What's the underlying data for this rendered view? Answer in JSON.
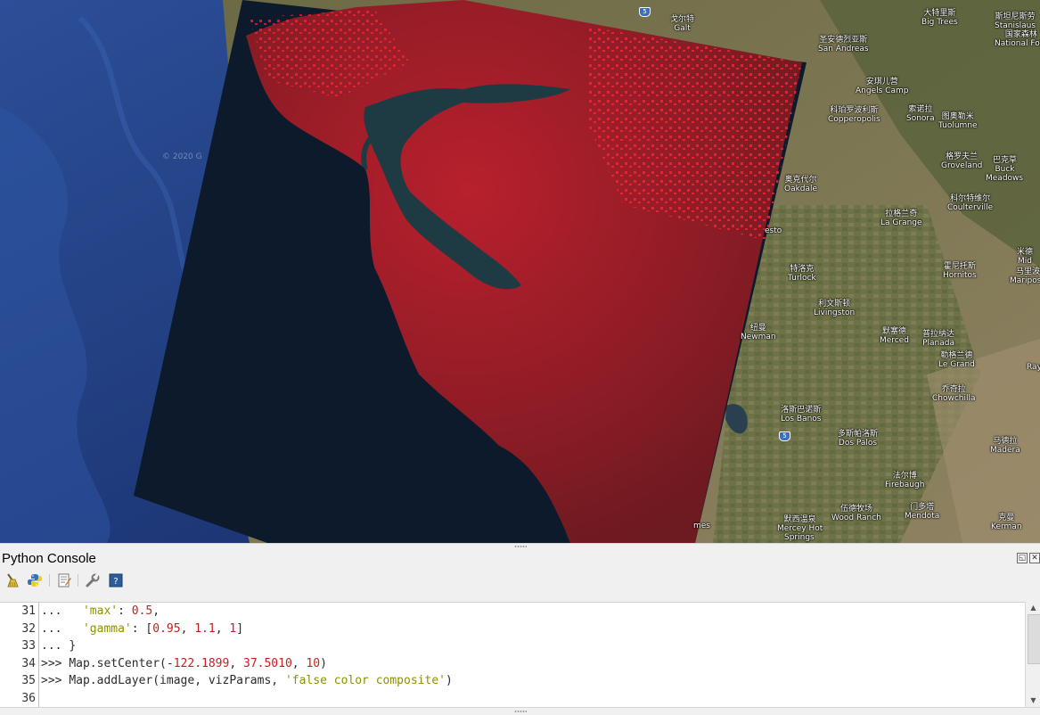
{
  "map": {
    "places": [
      {
        "zh": "戈尔特",
        "en": "Galt"
      },
      {
        "zh": "圣安德烈亚斯",
        "en": "San Andreas"
      },
      {
        "zh": "大特里斯",
        "en": "Big Trees"
      },
      {
        "zh": "斯坦尼斯劳",
        "en": "Stanislaus"
      },
      {
        "zh": "国家森林",
        "en": "National Fore"
      },
      {
        "zh": "安琪儿营",
        "en": "Angels Camp"
      },
      {
        "zh": "科珀罗波利斯",
        "en": "Copperopolis"
      },
      {
        "zh": "索诺拉",
        "en": "Sonora"
      },
      {
        "zh": "图奥勒米",
        "en": "Tuolumne"
      },
      {
        "zh": "格罗夫兰",
        "en": "Groveland"
      },
      {
        "zh": "巴克草",
        "en": "Buck"
      },
      {
        "zh": "",
        "en": "Meadows"
      },
      {
        "zh": "奥克代尔",
        "en": "Oakdale"
      },
      {
        "zh": "科尔特维尔",
        "en": "Coulterville"
      },
      {
        "zh": "拉格兰奇",
        "en": "La Grange"
      },
      {
        "zh": "特洛克",
        "en": "Turlock"
      },
      {
        "zh": "霍尼托斯",
        "en": "Hornitos"
      },
      {
        "zh": "利文斯顿",
        "en": "Livingston"
      },
      {
        "zh": "纽曼",
        "en": "Newman"
      },
      {
        "zh": "默塞德",
        "en": "Merced"
      },
      {
        "zh": "普拉纳达",
        "en": "Planada"
      },
      {
        "zh": "勒格兰德",
        "en": "Le Grand"
      },
      {
        "zh": "乔奇拉",
        "en": "Chowchilla"
      },
      {
        "zh": "洛斯巴诺斯",
        "en": "Los Banos"
      },
      {
        "zh": "多斯帕洛斯",
        "en": "Dos Palos"
      },
      {
        "zh": "马德拉",
        "en": "Madera"
      },
      {
        "zh": "法尔博",
        "en": "Firebaugh"
      },
      {
        "zh": "伍德牧场",
        "en": "Wood Ranch"
      },
      {
        "zh": "门多塔",
        "en": "Mendota"
      },
      {
        "zh": "默西温泉",
        "en": "Mercey Hot"
      },
      {
        "zh": "",
        "en": "Springs"
      },
      {
        "zh": "克曼",
        "en": "Kerman"
      },
      {
        "zh": "米德",
        "en": "Mid"
      },
      {
        "zh": "马里波",
        "en": "Mariposa"
      },
      {
        "zh": "",
        "en": "Ray"
      },
      {
        "zh": "",
        "en": "esto"
      },
      {
        "zh": "",
        "en": "mes"
      }
    ],
    "shields": [
      "5",
      "5"
    ],
    "watermark": "© 2020 G"
  },
  "console": {
    "title": "Python Console",
    "toolbar": [
      {
        "name": "clear-console-icon"
      },
      {
        "name": "run-command-icon"
      },
      {
        "name": "show-editor-icon"
      },
      {
        "name": "options-icon"
      },
      {
        "name": "help-icon"
      }
    ],
    "lines": [
      {
        "n": "31",
        "prompt": "...",
        "indent": "   ",
        "tokens": [
          {
            "t": "'max'",
            "c": "str"
          },
          {
            "t": ": ",
            "c": ""
          },
          {
            "t": "0.5",
            "c": "num"
          },
          {
            "t": ",",
            "c": ""
          }
        ]
      },
      {
        "n": "32",
        "prompt": "...",
        "indent": "   ",
        "tokens": [
          {
            "t": "'gamma'",
            "c": "str"
          },
          {
            "t": ": [",
            "c": ""
          },
          {
            "t": "0.95",
            "c": "num"
          },
          {
            "t": ", ",
            "c": ""
          },
          {
            "t": "1.1",
            "c": "num"
          },
          {
            "t": ", ",
            "c": ""
          },
          {
            "t": "1",
            "c": "num"
          },
          {
            "t": "]",
            "c": ""
          }
        ]
      },
      {
        "n": "33",
        "prompt": "...",
        "indent": " ",
        "tokens": [
          {
            "t": "}",
            "c": ""
          }
        ]
      },
      {
        "n": "34",
        "prompt": ">>>",
        "indent": " ",
        "tokens": [
          {
            "t": "Map.setCenter(-",
            "c": ""
          },
          {
            "t": "122.1899",
            "c": "num"
          },
          {
            "t": ", ",
            "c": ""
          },
          {
            "t": "37.5010",
            "c": "num"
          },
          {
            "t": ", ",
            "c": ""
          },
          {
            "t": "10",
            "c": "num"
          },
          {
            "t": ")",
            "c": ""
          }
        ]
      },
      {
        "n": "35",
        "prompt": ">>>",
        "indent": " ",
        "tokens": [
          {
            "t": "Map.addLayer(image, vizParams, ",
            "c": ""
          },
          {
            "t": "'false color composite'",
            "c": "str"
          },
          {
            "t": ")",
            "c": ""
          }
        ]
      },
      {
        "n": "36",
        "prompt": "",
        "indent": "",
        "tokens": []
      }
    ],
    "panel_buttons": {
      "float": "◱",
      "close": "✕"
    },
    "scroll_up": "▲",
    "scroll_down": "▼"
  }
}
